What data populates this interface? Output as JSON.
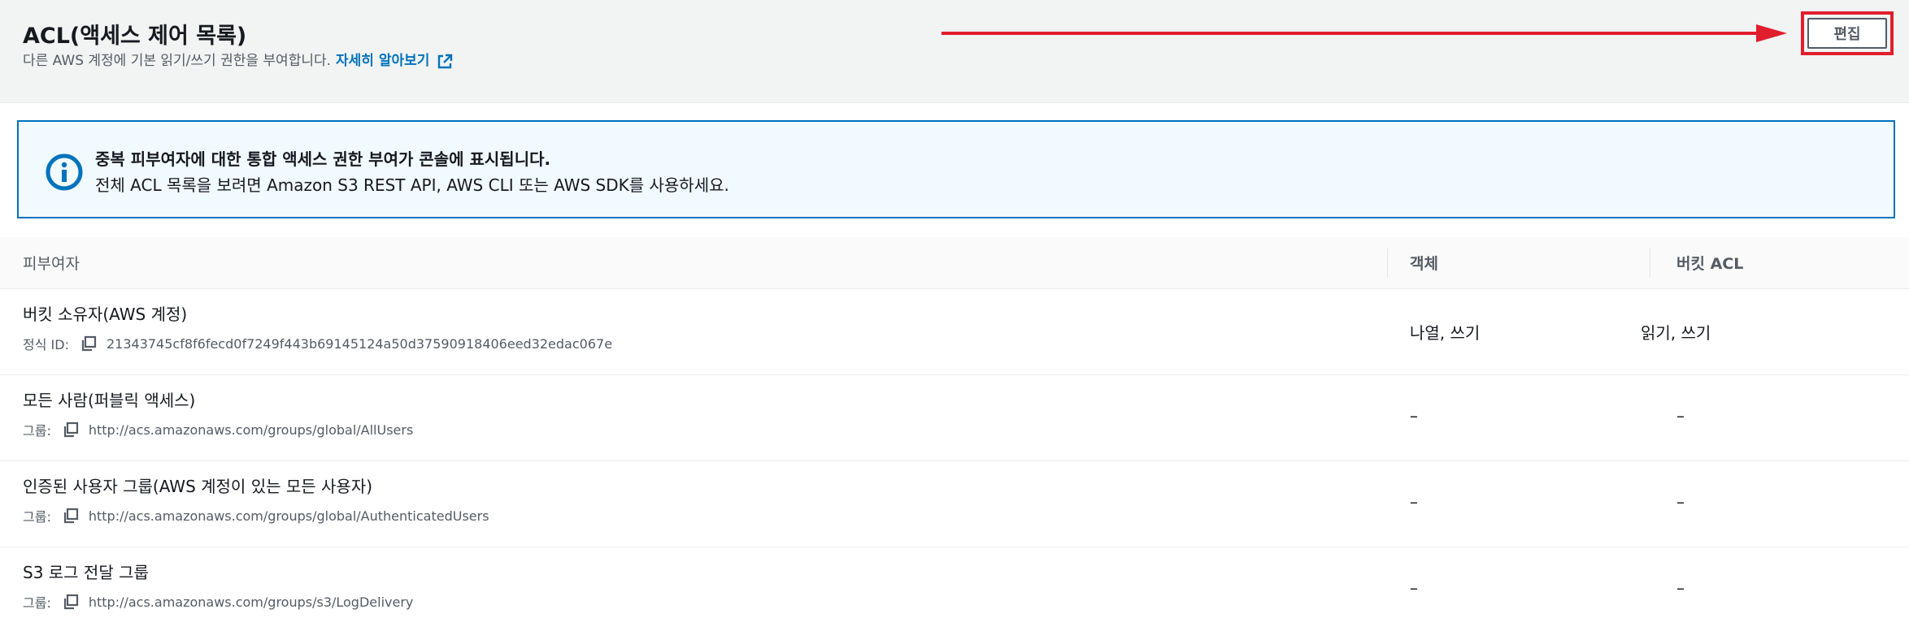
{
  "header": {
    "title": "ACL(액세스 제어 목록)",
    "description": "다른 AWS 계정에 기본 읽기/쓰기 권한을 부여합니다.",
    "learn_more": "자세히 알아보기",
    "learn_more_icon": "external-link-icon",
    "edit_label": "편집",
    "annotation_color": "#e01e2e"
  },
  "alert": {
    "icon": "info-icon",
    "title": "중복 피부여자에 대한 통합 액세스 권한 부여가 콘솔에 표시됩니다.",
    "body": "전체 ACL 목록을 보려면 Amazon S3 REST API, AWS CLI 또는 AWS SDK를 사용하세요."
  },
  "table": {
    "columns": [
      "피부여자",
      "객체",
      "버킷 ACL"
    ],
    "rows": [
      {
        "grantee": "버킷 소유자(AWS 계정)",
        "id_label": "정식 ID:",
        "id_value": "21343745cf8f6fecd0f7249f443b69145124a50d37590918406eed32edac067e",
        "objects": "나열, 쓰기",
        "bucket_acl": "읽기, 쓰기"
      },
      {
        "grantee": "모든 사람(퍼블릭 액세스)",
        "id_label": "그룹:",
        "id_value": "http://acs.amazonaws.com/groups/global/AllUsers",
        "objects": "–",
        "bucket_acl": "–"
      },
      {
        "grantee": "인증된 사용자 그룹(AWS 계정이 있는 모든 사용자)",
        "id_label": "그룹:",
        "id_value": "http://acs.amazonaws.com/groups/global/AuthenticatedUsers",
        "objects": "–",
        "bucket_acl": "–"
      },
      {
        "grantee": "S3 로그 전달 그룹",
        "id_label": "그룹:",
        "id_value": "http://acs.amazonaws.com/groups/s3/LogDelivery",
        "objects": "–",
        "bucket_acl": "–"
      }
    ]
  }
}
